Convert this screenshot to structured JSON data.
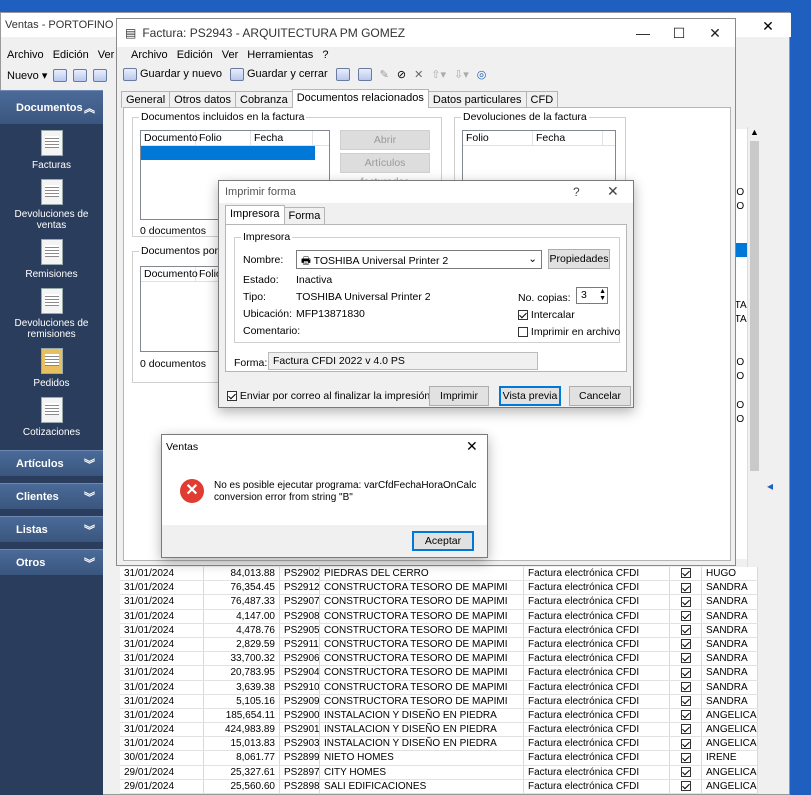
{
  "main_window": {
    "title": "Ventas - PORTOFINO STO",
    "menu": [
      "Archivo",
      "Edición",
      "Ver"
    ],
    "new_label": "Nuevo"
  },
  "sidebar": {
    "documentos_header": "Documentos",
    "items": [
      "Facturas",
      "Devoluciones de ventas",
      "Remisiones",
      "Devoluciones de remisiones",
      "Pedidos",
      "Cotizaciones"
    ],
    "sections": [
      "Artículos",
      "Clientes",
      "Listas",
      "Otros"
    ]
  },
  "right_col": [
    "A",
    "A",
    "A",
    "A",
    "MO",
    "MO",
    "A",
    "A",
    "A",
    "A",
    "A",
    "A",
    "ETA",
    "ETA",
    "O",
    "A",
    "MO",
    "MO",
    "A",
    "MO",
    "MO",
    "A",
    "A"
  ],
  "grid_rows": [
    {
      "fecha": "31/01/2024",
      "importe": "84,013.88",
      "folio": "PS2902",
      "cliente": "PIEDRAS DEL CERRO",
      "forma": "Factura electrónica CFDI",
      "checked": true,
      "agente": "HUGO"
    },
    {
      "fecha": "31/01/2024",
      "importe": "76,354.45",
      "folio": "PS2912",
      "cliente": "CONSTRUCTORA TESORO DE MAPIMI",
      "forma": "Factura electrónica CFDI",
      "checked": true,
      "agente": "SANDRA"
    },
    {
      "fecha": "31/01/2024",
      "importe": "76,487.33",
      "folio": "PS2907",
      "cliente": "CONSTRUCTORA TESORO DE MAPIMI",
      "forma": "Factura electrónica CFDI",
      "checked": true,
      "agente": "SANDRA"
    },
    {
      "fecha": "31/01/2024",
      "importe": "4,147.00",
      "folio": "PS2908",
      "cliente": "CONSTRUCTORA TESORO DE MAPIMI",
      "forma": "Factura electrónica CFDI",
      "checked": true,
      "agente": "SANDRA"
    },
    {
      "fecha": "31/01/2024",
      "importe": "4,478.76",
      "folio": "PS2905",
      "cliente": "CONSTRUCTORA TESORO DE MAPIMI",
      "forma": "Factura electrónica CFDI",
      "checked": true,
      "agente": "SANDRA"
    },
    {
      "fecha": "31/01/2024",
      "importe": "2,829.59",
      "folio": "PS2911",
      "cliente": "CONSTRUCTORA TESORO DE MAPIMI",
      "forma": "Factura electrónica CFDI",
      "checked": true,
      "agente": "SANDRA"
    },
    {
      "fecha": "31/01/2024",
      "importe": "33,700.32",
      "folio": "PS2906",
      "cliente": "CONSTRUCTORA TESORO DE MAPIMI",
      "forma": "Factura electrónica CFDI",
      "checked": true,
      "agente": "SANDRA"
    },
    {
      "fecha": "31/01/2024",
      "importe": "20,783.95",
      "folio": "PS2904",
      "cliente": "CONSTRUCTORA TESORO DE MAPIMI",
      "forma": "Factura electrónica CFDI",
      "checked": true,
      "agente": "SANDRA"
    },
    {
      "fecha": "31/01/2024",
      "importe": "3,639.38",
      "folio": "PS2910",
      "cliente": "CONSTRUCTORA TESORO DE MAPIMI",
      "forma": "Factura electrónica CFDI",
      "checked": true,
      "agente": "SANDRA"
    },
    {
      "fecha": "31/01/2024",
      "importe": "5,105.16",
      "folio": "PS2909",
      "cliente": "CONSTRUCTORA TESORO DE MAPIMI",
      "forma": "Factura electrónica CFDI",
      "checked": true,
      "agente": "SANDRA"
    },
    {
      "fecha": "31/01/2024",
      "importe": "185,654.11",
      "folio": "PS2900",
      "cliente": "INSTALACION Y DISEÑO EN PIEDRA",
      "forma": "Factura electrónica CFDI",
      "checked": true,
      "agente": "ANGELICA"
    },
    {
      "fecha": "31/01/2024",
      "importe": "424,983.89",
      "folio": "PS2901",
      "cliente": "INSTALACION Y DISEÑO EN PIEDRA",
      "forma": "Factura electrónica CFDI",
      "checked": true,
      "agente": "ANGELICA"
    },
    {
      "fecha": "31/01/2024",
      "importe": "15,013.83",
      "folio": "PS2903",
      "cliente": "INSTALACION Y DISEÑO EN PIEDRA",
      "forma": "Factura electrónica CFDI",
      "checked": true,
      "agente": "ANGELICA"
    },
    {
      "fecha": "30/01/2024",
      "importe": "8,061.77",
      "folio": "PS2899",
      "cliente": "NIETO HOMES",
      "forma": "Factura electrónica CFDI",
      "checked": true,
      "agente": "IRENE"
    },
    {
      "fecha": "29/01/2024",
      "importe": "25,327.61",
      "folio": "PS2897",
      "cliente": "CITY HOMES",
      "forma": "Factura electrónica CFDI",
      "checked": true,
      "agente": "ANGELICA"
    },
    {
      "fecha": "29/01/2024",
      "importe": "25,560.60",
      "folio": "PS2898",
      "cliente": "SALI EDIFICACIONES",
      "forma": "Factura electrónica CFDI",
      "checked": true,
      "agente": "ANGELICA"
    }
  ],
  "factura": {
    "title": "Factura: PS2943 - ARQUITECTURA PM GOMEZ",
    "menu": [
      "Archivo",
      "Edición",
      "Ver",
      "Herramientas",
      "?"
    ],
    "toolbar": {
      "guardar_nuevo": "Guardar y nuevo",
      "guardar_cerrar": "Guardar y cerrar"
    },
    "tabs": [
      "General",
      "Otros datos",
      "Cobranza",
      "Documentos relacionados",
      "Datos particulares",
      "CFD"
    ],
    "docs_incluidos": {
      "label": "Documentos incluidos en la factura",
      "cols": [
        "Documento",
        "Folio",
        "Fecha"
      ],
      "count": "0 documentos"
    },
    "docs_por": {
      "label": "Documentos por fac",
      "cols": [
        "Documento",
        "Folio"
      ],
      "count": "0 documentos"
    },
    "devoluciones": {
      "label": "Devoluciones de la factura",
      "cols": [
        "Folio",
        "Fecha"
      ]
    },
    "buttons": {
      "abrir": "Abrir",
      "articulos": "Artículos facturados"
    }
  },
  "imprimir": {
    "title": "Imprimir forma",
    "help": "?",
    "tabs": [
      "Impresora",
      "Forma"
    ],
    "group": "Impresora",
    "nombre_label": "Nombre:",
    "nombre": "TOSHIBA Universal Printer 2",
    "propiedades": "Propiedades",
    "estado_label": "Estado:",
    "estado": "Inactiva",
    "tipo_label": "Tipo:",
    "tipo": "TOSHIBA Universal Printer 2",
    "ubicacion_label": "Ubicación:",
    "ubicacion": "MFP13871830",
    "comentario_label": "Comentario:",
    "copias_label": "No. copias:",
    "copias": "3",
    "intercalar": "Intercalar",
    "imprimir_archivo": "Imprimir en archivo",
    "forma_label": "Forma:",
    "forma": "Factura CFDI 2022 v 4.0 PS",
    "enviar_correo": "Enviar por correo al finalizar la impresión",
    "btn_imprimir": "Imprimir",
    "btn_vista": "Vista previa",
    "btn_cancelar": "Cancelar"
  },
  "error": {
    "title": "Ventas",
    "message_1": "No es posible ejecutar programa: varCfdFechaHoraOnCalc",
    "message_2": "conversion error from string \"B\"",
    "ok": "Aceptar"
  }
}
